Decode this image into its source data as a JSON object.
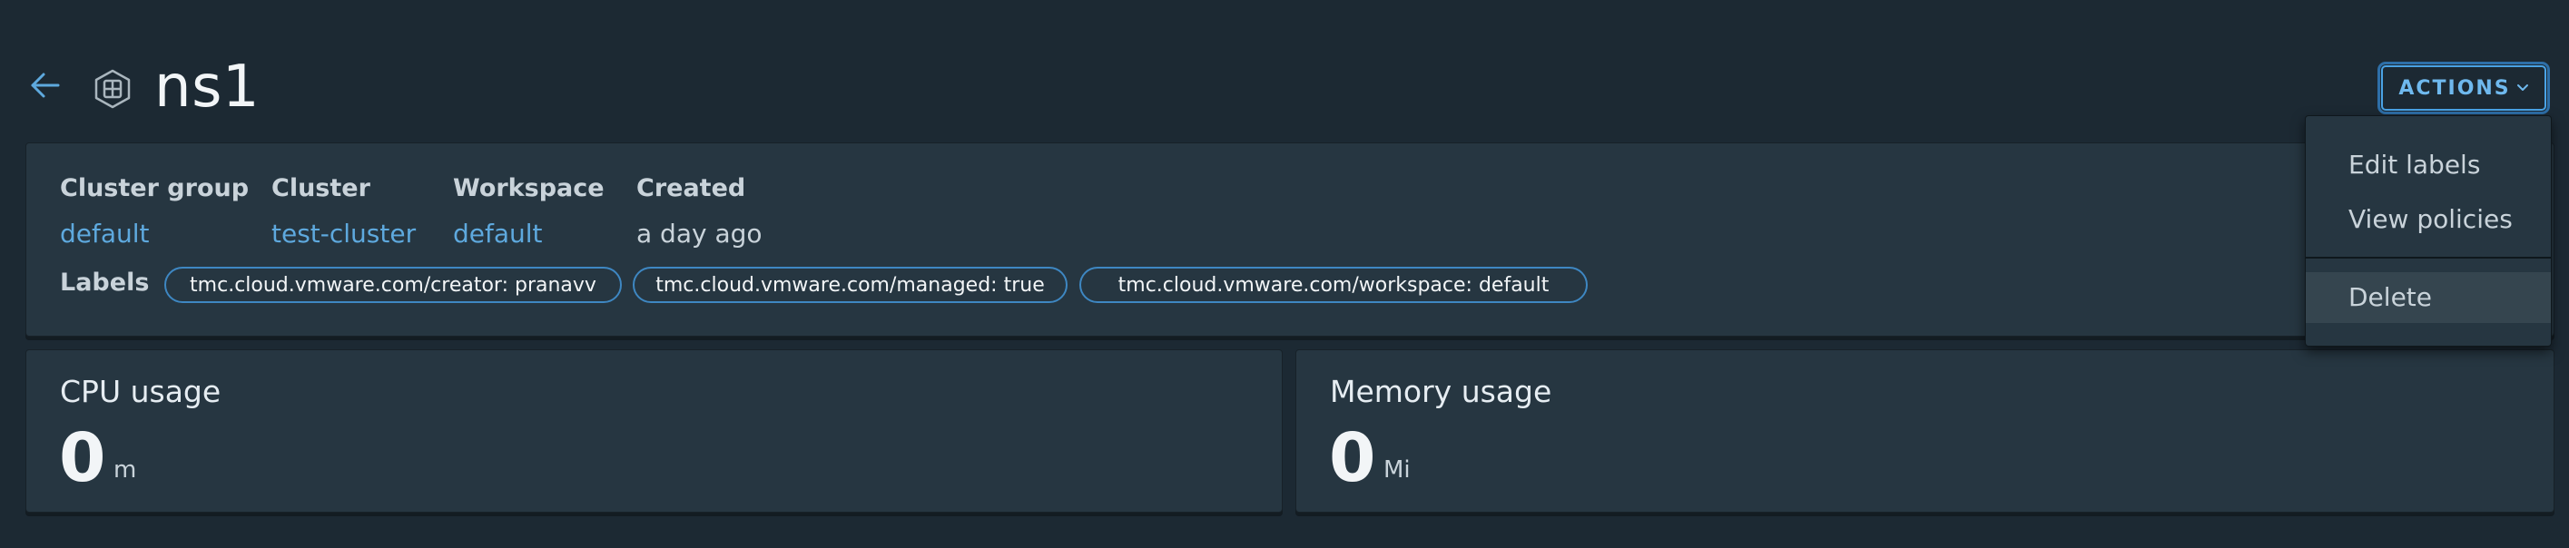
{
  "header": {
    "title": "ns1",
    "back_icon": "arrow-left-icon",
    "namespace_icon": "namespace-icon",
    "actions_label": "ACTIONS",
    "actions_icon": "chevron-down-icon"
  },
  "details": {
    "cluster_group": {
      "label": "Cluster group",
      "value": "default"
    },
    "cluster": {
      "label": "Cluster",
      "value": "test-cluster"
    },
    "workspace": {
      "label": "Workspace",
      "value": "default"
    },
    "created": {
      "label": "Created",
      "value": "a day ago"
    },
    "labels_title": "Labels",
    "labels": [
      "tmc.cloud.vmware.com/creator: pranavv",
      "tmc.cloud.vmware.com/managed: true",
      "tmc.cloud.vmware.com/workspace: default"
    ]
  },
  "cpu": {
    "title": "CPU usage",
    "value": "0",
    "unit": "m"
  },
  "memory": {
    "title": "Memory usage",
    "value": "0",
    "unit": "Mi"
  },
  "actions_menu": {
    "items": [
      "Edit labels",
      "View policies",
      "Delete"
    ]
  },
  "colors": {
    "background": "#1c2933",
    "card": "#263641",
    "link": "#5ea9de",
    "accent": "#4aa3e6"
  }
}
